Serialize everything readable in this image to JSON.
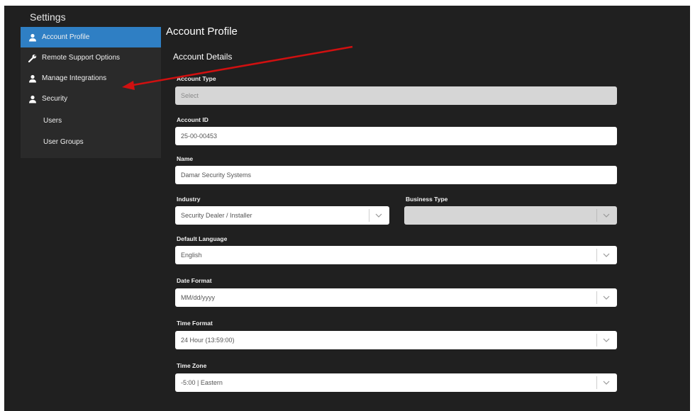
{
  "app": {
    "title": "Settings"
  },
  "sidebar": {
    "items": [
      {
        "label": "Account Profile",
        "icon": "user-icon",
        "active": true
      },
      {
        "label": "Remote Support Options",
        "icon": "wrench-icon"
      },
      {
        "label": "Manage Integrations",
        "icon": "user-icon"
      },
      {
        "label": "Security",
        "icon": "user-icon"
      },
      {
        "label": "Users"
      },
      {
        "label": "User Groups"
      }
    ]
  },
  "main": {
    "page_title": "Account Profile",
    "section_title": "Account Details",
    "fields": {
      "account_type": {
        "label": "Account Type",
        "value": "Select"
      },
      "account_id": {
        "label": "Account ID",
        "value": "25-00-00453"
      },
      "name": {
        "label": "Name",
        "value": "Damar Security Systems"
      },
      "industry": {
        "label": "Industry",
        "value": "Security Dealer / Installer"
      },
      "business_type": {
        "label": "Business Type",
        "value": ""
      },
      "default_language": {
        "label": "Default Language",
        "value": "English"
      },
      "date_format": {
        "label": "Date Format",
        "value": "MM/dd/yyyy"
      },
      "time_format": {
        "label": "Time Format",
        "value": "24 Hour (13:59:00)"
      },
      "time_zone": {
        "label": "Time Zone",
        "value": "-5:00 | Eastern"
      }
    }
  },
  "colors": {
    "background": "#202020",
    "sidebar": "#2a2a2a",
    "active": "#2f7fc4",
    "annotation_arrow": "#d01010"
  }
}
